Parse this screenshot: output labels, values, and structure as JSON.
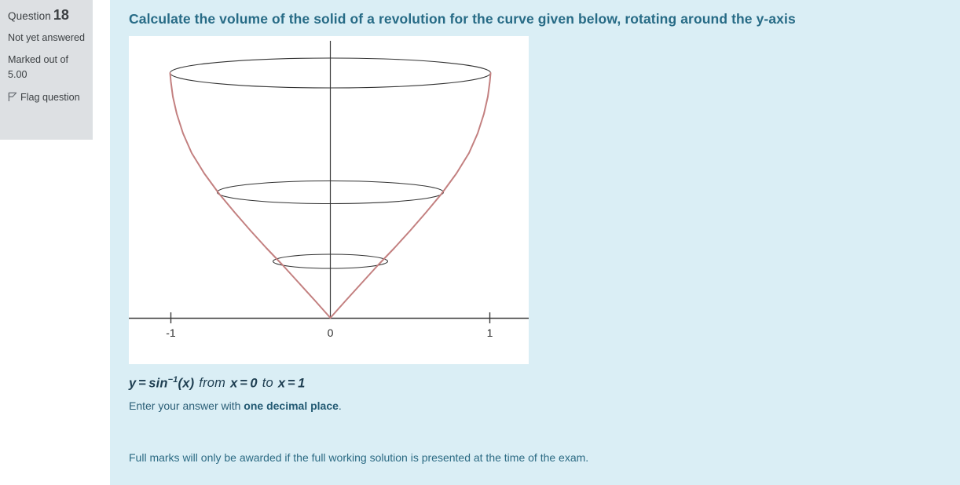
{
  "sidebar": {
    "question_word": "Question",
    "question_number": "18",
    "status": "Not yet answered",
    "marked_out_of": "Marked out of 5.00",
    "flag_label": "Flag question",
    "flag_icon": "flag-icon",
    "background_color": "#dde0e3"
  },
  "content": {
    "background_color": "#daeef5",
    "title": "Calculate the volume of the solid of a revolution for the curve given below, rotating around the y-axis",
    "title_color": "#276b86",
    "formula": {
      "lhs": "y",
      "equals": "=",
      "fn": "sin",
      "exponent": "−1",
      "arg": "(x)",
      "from_word": "from",
      "from_var": "x",
      "from_eq": "=",
      "from_val": "0",
      "to_word": "to",
      "to_var": "x",
      "to_eq": "=",
      "to_val": "1",
      "plain": "y = sin⁻¹(x) from x = 0 to x = 1"
    },
    "answer_note_prefix": "Enter your answer with ",
    "answer_note_bold": "one decimal place",
    "answer_note_suffix": ".",
    "marks_note": "Full marks will only be awarded if the full working solution is presented at the time of the exam."
  },
  "chart_data": {
    "type": "line",
    "title": "",
    "xlabel": "",
    "ylabel": "",
    "description": "Solid of revolution generated by rotating y = arcsin(x) about the y-axis; a horn/funnel shaped surface drawn with three horizontal cross-section ellipses.",
    "curve_color": "#c38080",
    "axis_color": "#3a3a3a",
    "ellipse_color": "#333333",
    "background_color": "#ffffff",
    "grid": false,
    "legend": null,
    "xlim": [
      -1.35,
      1.35
    ],
    "ylim": [
      0,
      1.6
    ],
    "xticks": [
      -1,
      0,
      1
    ],
    "xtick_labels": [
      "-1",
      "0",
      "1"
    ],
    "yticks": [],
    "ytick_labels": [],
    "series": [
      {
        "name": "y = arcsin(x) right branch",
        "x": [
          0.0,
          0.1,
          0.2,
          0.3,
          0.4,
          0.5,
          0.6,
          0.7,
          0.8,
          0.9,
          0.95,
          0.98,
          1.0
        ],
        "y": [
          0.0,
          0.1002,
          0.2014,
          0.3047,
          0.4115,
          0.5236,
          0.6435,
          0.7754,
          0.9273,
          1.1198,
          1.2532,
          1.3705,
          1.5708
        ]
      },
      {
        "name": "y = arcsin(x) left branch (mirror)",
        "x": [
          0.0,
          -0.1,
          -0.2,
          -0.3,
          -0.4,
          -0.5,
          -0.6,
          -0.7,
          -0.8,
          -0.9,
          -0.95,
          -0.98,
          -1.0
        ],
        "y": [
          0.0,
          0.1002,
          0.2014,
          0.3047,
          0.4115,
          0.5236,
          0.6435,
          0.7754,
          0.9273,
          1.1198,
          1.2532,
          1.3705,
          1.5708
        ]
      }
    ],
    "cross_sections": [
      {
        "label": "top-ellipse",
        "y": 1.5708,
        "radius": 1.0
      },
      {
        "label": "middle-ellipse",
        "y": 0.7754,
        "radius": 0.7
      },
      {
        "label": "bottom-ellipse",
        "y": 0.3047,
        "radius": 0.36
      }
    ]
  }
}
